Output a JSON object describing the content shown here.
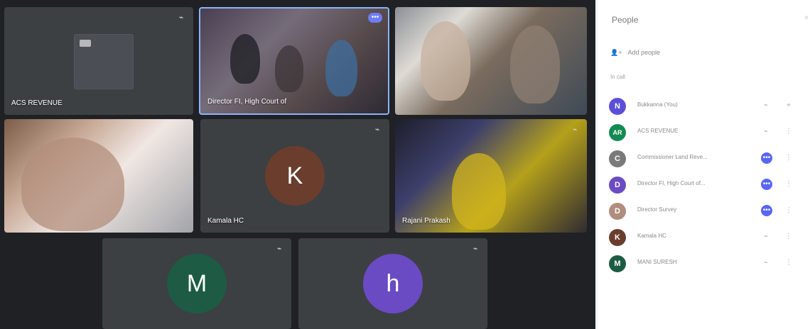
{
  "sidebar": {
    "title": "People",
    "add_label": "Add people",
    "section_label": "In call",
    "participants": [
      {
        "name": "Bukkanna (You)",
        "avatar_letter": "N",
        "avatar_color": "#5b4fd8",
        "primary_icon": "mic-off-icon",
        "secondary_icon": "pin-icon"
      },
      {
        "name": "ACS REVENUE",
        "avatar_letter": "AR",
        "avatar_color": "#138a52",
        "primary_icon": "mic-off-icon",
        "secondary_icon": "more-vert-icon"
      },
      {
        "name": "Commissioner Land Reve...",
        "avatar_letter": "C",
        "avatar_color": "#7a7a7a",
        "primary_icon": "audio-level-icon",
        "secondary_icon": "more-vert-icon"
      },
      {
        "name": "Director FI, High Court of...",
        "avatar_letter": "D",
        "avatar_color": "#6a4bc3",
        "primary_icon": "audio-level-icon",
        "secondary_icon": "more-vert-icon"
      },
      {
        "name": "Director Survey",
        "avatar_letter": "D",
        "avatar_color": "#b08d7f",
        "primary_icon": "audio-level-icon",
        "secondary_icon": "more-vert-icon"
      },
      {
        "name": "Kamala HC",
        "avatar_letter": "K",
        "avatar_color": "#6a3d2d",
        "primary_icon": "mic-off-icon",
        "secondary_icon": "more-vert-icon"
      },
      {
        "name": "MANI SURESH",
        "avatar_letter": "M",
        "avatar_color": "#1d5b44",
        "primary_icon": "mic-off-icon",
        "secondary_icon": "more-vert-icon"
      }
    ]
  },
  "tiles": {
    "acs_revenue": {
      "name": "ACS REVENUE",
      "status_icon": "mic-off-icon"
    },
    "director_fi": {
      "name": "Director FI, High Court of",
      "badge_icon": "audio-level-icon"
    },
    "kamala": {
      "name": "Kamala HC",
      "letter": "K",
      "status_icon": "mic-off-icon"
    },
    "rajani": {
      "name": "Rajani Prakash",
      "status_icon": "mic-off-icon"
    },
    "mani": {
      "letter": "M",
      "status_icon": "mic-off-icon"
    },
    "h_user": {
      "letter": "h",
      "status_icon": "mic-off-icon"
    }
  },
  "colors": {
    "call_background": "#202124",
    "tile_background": "#3c4043",
    "accent_blue": "#8ab4f8",
    "sidebar_background": "#ffffff"
  }
}
